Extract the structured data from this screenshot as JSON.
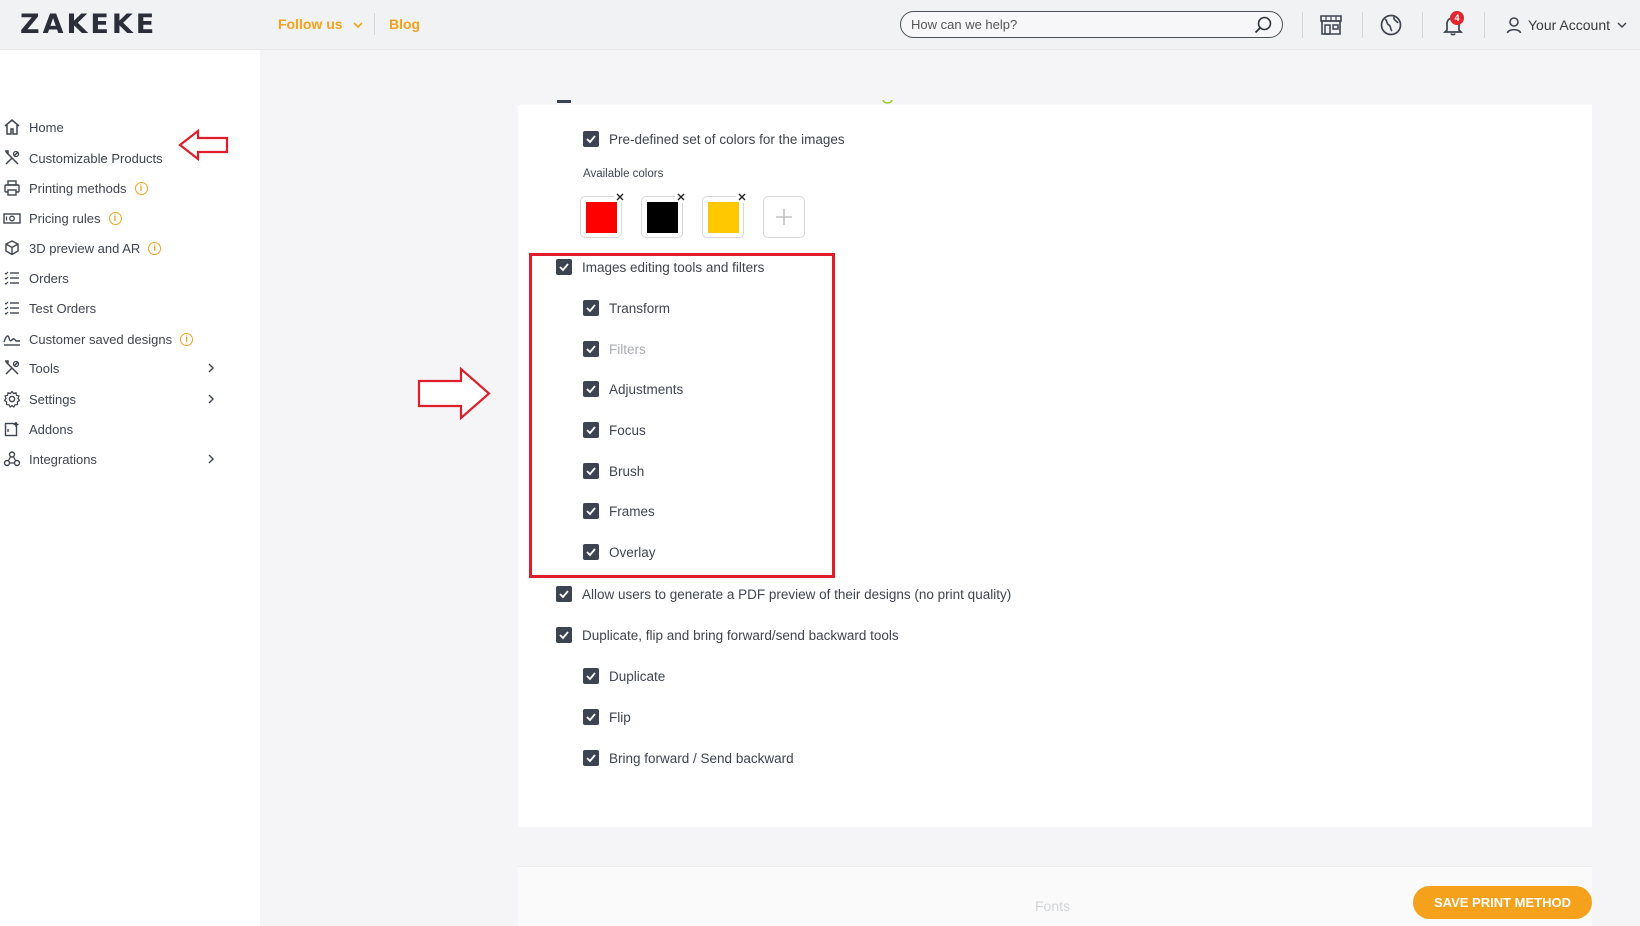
{
  "topbar": {
    "logo": "ZAKEKE",
    "follow_label": "Follow us",
    "blog_label": "Blog",
    "search_placeholder": "How can we help?",
    "notifications_count": "4",
    "account_label": "Your Account"
  },
  "sidebar": {
    "items": [
      {
        "label": "Home",
        "icon": "home-icon"
      },
      {
        "label": "Customizable Products",
        "icon": "tools-icon"
      },
      {
        "label": "Printing methods",
        "icon": "printer-icon"
      },
      {
        "label": "Pricing rules",
        "icon": "money-icon"
      },
      {
        "label": "3D preview and AR",
        "icon": "cube-icon"
      },
      {
        "label": "Orders",
        "icon": "list-icon"
      },
      {
        "label": "Test Orders",
        "icon": "list-icon"
      },
      {
        "label": "Customer saved designs",
        "icon": "signature-icon"
      },
      {
        "label": "Tools",
        "icon": "tools-icon"
      },
      {
        "label": "Settings",
        "icon": "gear-icon"
      },
      {
        "label": "Addons",
        "icon": "addon-icon"
      },
      {
        "label": "Integrations",
        "icon": "integrations-icon"
      }
    ]
  },
  "main": {
    "predefined_colors": "Pre-defined set of colors for the images",
    "available_colors_label": "Available colors",
    "colors": [
      "#ff0000",
      "#000000",
      "#ffc800"
    ],
    "image_tools": "Images editing tools and filters",
    "image_tool_items": [
      "Transform",
      "Filters",
      "Adjustments",
      "Focus",
      "Brush",
      "Frames",
      "Overlay"
    ],
    "pdf_preview": "Allow users to generate a PDF preview of their designs (no print quality)",
    "duplicate_tools": "Duplicate, flip and bring forward/send backward tools",
    "duplicate_items": [
      "Duplicate",
      "Flip",
      "Bring forward / Send backward"
    ],
    "fonts_heading": "Fonts",
    "save_button": "SAVE PRINT METHOD"
  },
  "colors": {
    "accent": "#f5a11c",
    "annotation_red": "#e01d2a",
    "checkbox": "#3c4452"
  }
}
